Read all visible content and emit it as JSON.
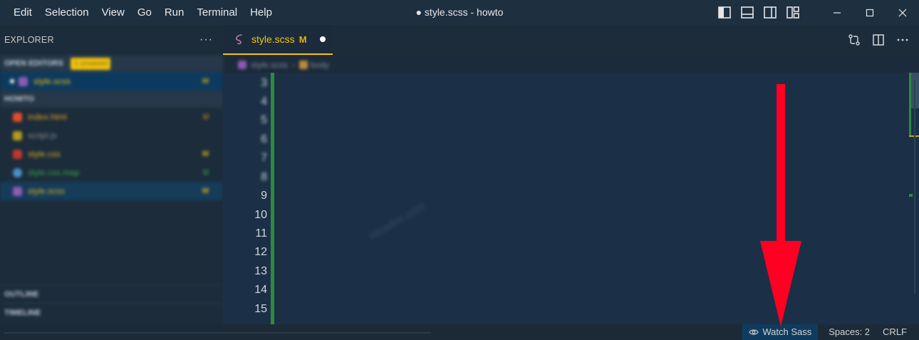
{
  "menu": [
    "Edit",
    "Selection",
    "View",
    "Go",
    "Run",
    "Terminal",
    "Help"
  ],
  "window_title": "● style.scss - howto",
  "sidebar": {
    "title": "EXPLORER",
    "more": "···",
    "open_editors": {
      "label": "OPEN EDITORS",
      "badge": "1 unsaved"
    },
    "open_files": [
      {
        "name": "style.scss",
        "status": "M",
        "color": "#f3c40f"
      }
    ],
    "folder": {
      "label": "HOWTO"
    },
    "files": [
      {
        "name": "index.html",
        "status": "U",
        "color": "#e4a11b",
        "icon_color": "#e44d26"
      },
      {
        "name": "script.js",
        "status": "",
        "color": "#8a8a8a",
        "icon_color": "#b59b1e"
      },
      {
        "name": "style.css",
        "status": "M",
        "color": "#d9b21c",
        "icon_color": "#c0392b"
      },
      {
        "name": "style.css.map",
        "status": "U",
        "color": "#3aa64a",
        "icon_color": "#4a90c8"
      },
      {
        "name": "style.scss",
        "status": "M",
        "color": "#d9b21c",
        "icon_color": "#8e5bb4"
      }
    ],
    "outline": "OUTLINE",
    "timeline": "TIMELINE"
  },
  "tab": {
    "label": "style.scss",
    "modified": "M"
  },
  "breadcrumb": {
    "file": "style.scss",
    "symbol": "body"
  },
  "editor": {
    "line_numbers": [
      "3",
      "4",
      "5",
      "6",
      "7",
      "8",
      "9",
      "10",
      "11",
      "12",
      "13",
      "14",
      "15"
    ],
    "watermark": "sassdoc.com"
  },
  "statusbar": {
    "watch_sass": "Watch Sass",
    "spaces": "Spaces: 2",
    "eol": "CRLF"
  },
  "colors": {
    "accent": "#f2c40f",
    "arrow": "#ff0022",
    "gutter_modified": "#2e8a3e"
  }
}
